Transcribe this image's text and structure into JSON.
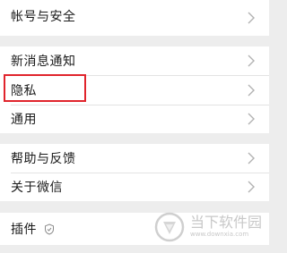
{
  "groups": [
    {
      "items": [
        {
          "label": "帐号与安全"
        }
      ]
    },
    {
      "items": [
        {
          "label": "新消息通知"
        },
        {
          "label": "隐私"
        },
        {
          "label": "通用"
        }
      ]
    },
    {
      "items": [
        {
          "label": "帮助与反馈"
        },
        {
          "label": "关于微信"
        }
      ]
    },
    {
      "items": [
        {
          "label": "插件",
          "icon": "shield-icon"
        }
      ]
    }
  ],
  "highlight": {
    "target": "隐私",
    "color": "#e0242c"
  },
  "watermark": {
    "text": "当下软件园",
    "url": "www.downxia.com"
  },
  "colors": {
    "background": "#ededed",
    "row": "#ffffff",
    "chevron": "#b2b2b2"
  }
}
